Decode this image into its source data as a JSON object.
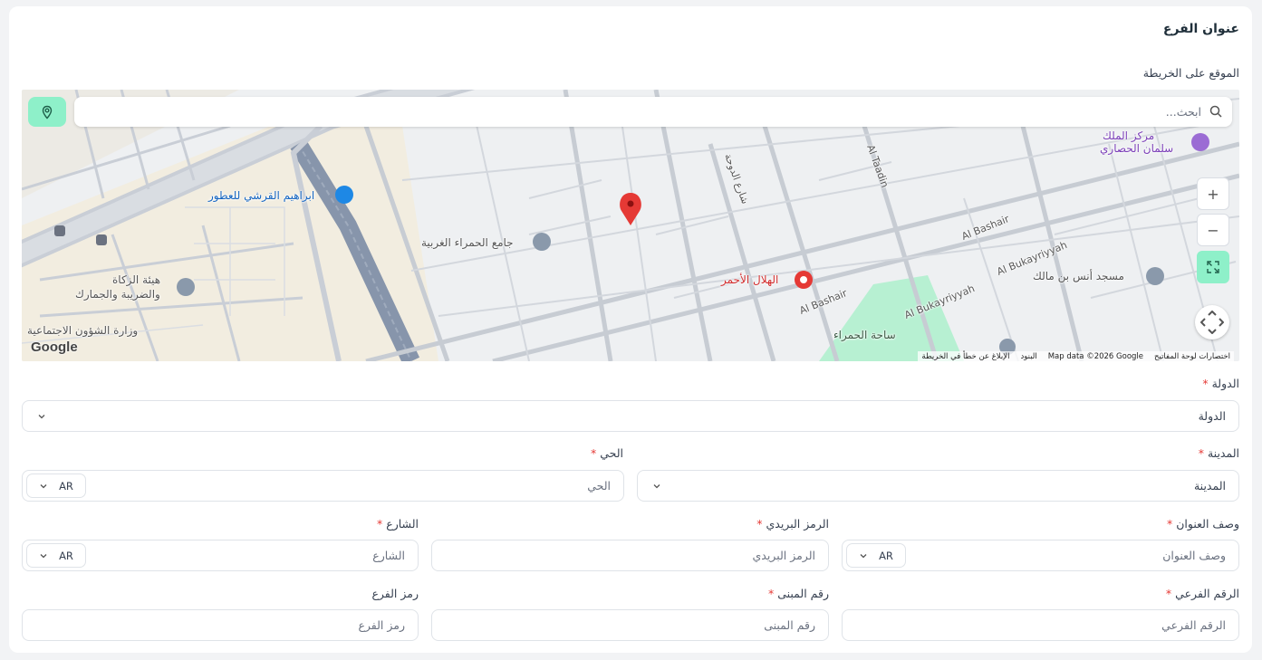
{
  "section_title": "عنوان الفرع",
  "map": {
    "label": "الموقع على الخريطة",
    "search_placeholder": "ابحث...",
    "zoom_in": "+",
    "zoom_out": "−",
    "google": "Google",
    "attribution": [
      "اختصارات لوحة المفاتيح",
      "Map data ©2026 Google",
      "البنود",
      "الإبلاغ عن خطأ في الخريطة"
    ],
    "labels": {
      "king_center": "مركز الملك",
      "salman": "سلمان الحصاري",
      "ibrahim": "ابراهيم القرشي للعطور",
      "mosque_hamra": "جامع الحمراء الغربية",
      "helal": "الهلال الأحمر",
      "anas": "مسجد أنس بن مالك",
      "zakat": "هيئة الزكاة",
      "zakat2": "والضريبة والجمارك",
      "social": "وزارة الشؤون الاجتماعية",
      "hamra_sq": "ساحة الحمراء",
      "al_bashair": "Al Bashair",
      "al_bukayriyyah": "Al Bukayriyyah",
      "al_taadin": "Al Taadin",
      "doha_st": "شارع الدوحة"
    }
  },
  "country": {
    "label": "الدولة",
    "placeholder": "الدولة"
  },
  "city": {
    "label": "المدينة",
    "placeholder": "المدينة"
  },
  "district": {
    "label": "الحي",
    "placeholder": "الحي",
    "lang": "AR"
  },
  "address_desc": {
    "label": "وصف العنوان",
    "placeholder": "وصف العنوان",
    "lang": "AR"
  },
  "postal": {
    "label": "الرمز البريدي",
    "placeholder": "الرمز البريدي"
  },
  "street": {
    "label": "الشارع",
    "placeholder": "الشارع",
    "lang": "AR"
  },
  "sub_number": {
    "label": "الرقم الفرعي",
    "placeholder": "الرقم الفرعي"
  },
  "building": {
    "label": "رقم المبنى",
    "placeholder": "رقم المبنى"
  },
  "branch_code": {
    "label": "رمز الفرع",
    "placeholder": "رمز الفرع"
  },
  "required_mark": "*",
  "colors": {
    "accent": "#8ef0c9",
    "required": "#e53935",
    "pin": "#e53935"
  }
}
